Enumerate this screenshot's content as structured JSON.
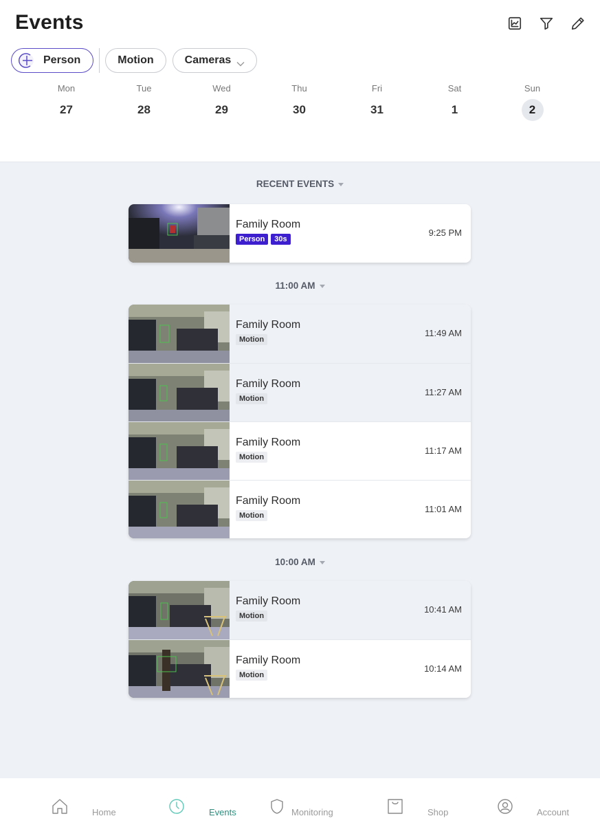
{
  "header": {
    "title": "Events",
    "icons": [
      "chart-icon",
      "filter-icon",
      "edit-icon"
    ]
  },
  "filters": [
    {
      "label": "Person",
      "active": true,
      "icon": "add-circle-icon"
    },
    {
      "label": "Motion",
      "active": false
    },
    {
      "label": "Cameras",
      "active": false,
      "dropdown": true
    }
  ],
  "calendar": [
    {
      "dow": "Mon",
      "date": "27"
    },
    {
      "dow": "Tue",
      "date": "28"
    },
    {
      "dow": "Wed",
      "date": "29"
    },
    {
      "dow": "Thu",
      "date": "30"
    },
    {
      "dow": "Fri",
      "date": "31"
    },
    {
      "dow": "Sat",
      "date": "1"
    },
    {
      "dow": "Sun",
      "date": "2",
      "selected": true
    }
  ],
  "sections": [
    {
      "title": "RECENT EVENTS",
      "events": [
        {
          "camera": "Family Room",
          "tags": [
            {
              "label": "Person",
              "type": "person"
            },
            {
              "label": "30s",
              "type": "person"
            }
          ],
          "time": "9:25 PM"
        }
      ]
    },
    {
      "title": "11:00 AM",
      "events": [
        {
          "camera": "Family Room",
          "tags": [
            {
              "label": "Motion",
              "type": "motion"
            }
          ],
          "time": "11:49 AM"
        },
        {
          "camera": "Family Room",
          "tags": [
            {
              "label": "Motion",
              "type": "motion"
            }
          ],
          "time": "11:27 AM"
        },
        {
          "camera": "Family Room",
          "tags": [
            {
              "label": "Motion",
              "type": "motion"
            }
          ],
          "time": "11:17 AM"
        },
        {
          "camera": "Family Room",
          "tags": [
            {
              "label": "Motion",
              "type": "motion"
            }
          ],
          "time": "11:01 AM"
        }
      ]
    },
    {
      "title": "10:00 AM",
      "events": [
        {
          "camera": "Family Room",
          "tags": [
            {
              "label": "Motion",
              "type": "motion"
            }
          ],
          "time": "10:41 AM"
        },
        {
          "camera": "Family Room",
          "tags": [
            {
              "label": "Motion",
              "type": "motion"
            }
          ],
          "time": "10:14 AM"
        }
      ]
    }
  ],
  "nav": [
    {
      "label": "Home",
      "icon": "home-icon"
    },
    {
      "label": "Events",
      "icon": "clock-icon",
      "active": true
    },
    {
      "label": "Monitoring",
      "icon": "shield-icon"
    },
    {
      "label": "Shop",
      "icon": "shopping-bag-icon"
    },
    {
      "label": "Account",
      "icon": "account-icon"
    }
  ],
  "colors": {
    "accent_purple": "#3d1fcf",
    "chip_active_border": "#5a4bc7",
    "nav_active": "#5fc9b8",
    "background": "#eef1f6"
  }
}
